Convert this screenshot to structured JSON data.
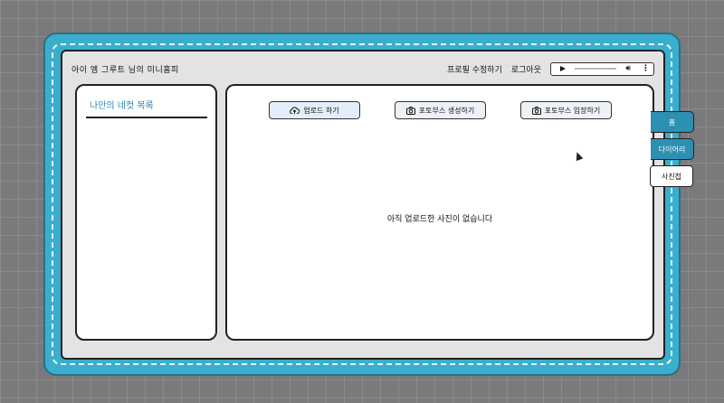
{
  "header": {
    "title": "아이 엠 그루트 님의 미니홈피",
    "edit_profile": "프로필 수정하기",
    "logout": "로그아웃"
  },
  "player": {
    "play_icon": "play-icon",
    "volume_icon": "volume-icon",
    "menu_icon": "more-vertical-icon"
  },
  "sidebar": {
    "title": "나만의 네컷 목록"
  },
  "main": {
    "upload_label": "업로드 하기",
    "create_booth_label": "포토부스 생성하기",
    "enter_booth_label": "포토부스 입장하기",
    "empty_message": "아직 업로드한 사진이 없습니다"
  },
  "tabs": [
    {
      "label": "홈"
    },
    {
      "label": "다이어리"
    },
    {
      "label": "사진첩"
    }
  ],
  "colors": {
    "frame": "#3aaecd",
    "tab_active": "#2d90b3",
    "sidebar_title": "#2d88ad"
  }
}
